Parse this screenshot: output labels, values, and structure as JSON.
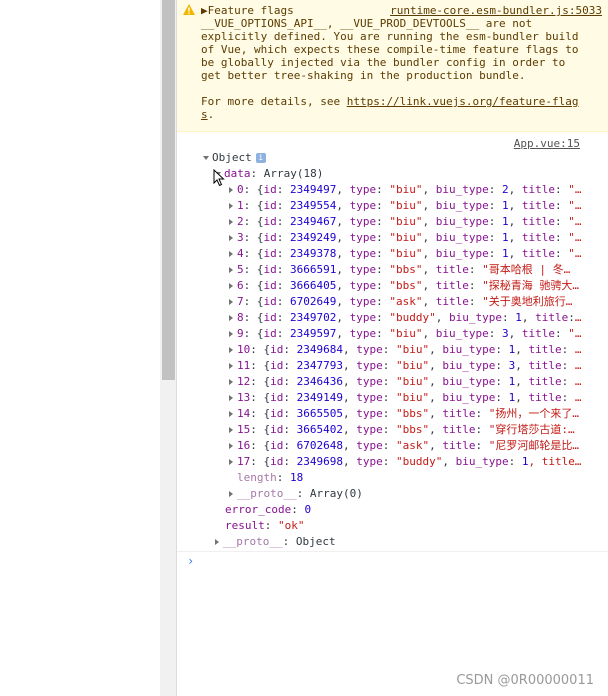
{
  "warning": {
    "message": "▶Feature flags\n__VUE_OPTIONS_API__, __VUE_PROD_DEVTOOLS__ are not\nexplicitly defined. You are running the esm-bundler build\nof Vue, which expects these compile-time feature flags to\nbe globally injected via the bundler config in order to\nget better tree-shaking in the production bundle.\n\nFor more details, see ",
    "link_text": "https://link.vuejs.org/feature-flag",
    "link_tail": "s",
    "tail": ".",
    "source": "runtime-core.esm-bundler.js:5033"
  },
  "log": {
    "source": "App.vue:15",
    "object_label": "Object",
    "info_badge": "i",
    "data_key": "data",
    "data_preview": "Array(18)",
    "items": [
      {
        "idx": "0",
        "id": "2349497",
        "type": "\"biu\"",
        "extra": ", biu_type: ",
        "extra_num": "2",
        "tail": ", title: \"…"
      },
      {
        "idx": "1",
        "id": "2349554",
        "type": "\"biu\"",
        "extra": ", biu_type: ",
        "extra_num": "1",
        "tail": ", title: \"…"
      },
      {
        "idx": "2",
        "id": "2349467",
        "type": "\"biu\"",
        "extra": ", biu_type: ",
        "extra_num": "1",
        "tail": ", title: \"…"
      },
      {
        "idx": "3",
        "id": "2349249",
        "type": "\"biu\"",
        "extra": ", biu_type: ",
        "extra_num": "1",
        "tail": ", title: \"…"
      },
      {
        "idx": "4",
        "id": "2349378",
        "type": "\"biu\"",
        "extra": ", biu_type: ",
        "extra_num": "1",
        "tail": ", title: \"…"
      },
      {
        "idx": "5",
        "id": "3666591",
        "type": "\"bbs\"",
        "extra": ", title: ",
        "extra_num": "",
        "tail": "\"哥本哈根 | 冬…"
      },
      {
        "idx": "6",
        "id": "3666405",
        "type": "\"bbs\"",
        "extra": ", title: ",
        "extra_num": "",
        "tail": "\"探秘青海 驰骋大…"
      },
      {
        "idx": "7",
        "id": "6702649",
        "type": "\"ask\"",
        "extra": ", title: ",
        "extra_num": "",
        "tail": "\"关于奥地利旅行…"
      },
      {
        "idx": "8",
        "id": "2349702",
        "type": "\"buddy\"",
        "extra": ", biu_type: ",
        "extra_num": "1",
        "tail": ", title:…"
      },
      {
        "idx": "9",
        "id": "2349597",
        "type": "\"biu\"",
        "extra": ", biu_type: ",
        "extra_num": "3",
        "tail": ", title: \"…"
      },
      {
        "idx": "10",
        "id": "2349684",
        "type": "\"biu\"",
        "extra": ", biu_type: ",
        "extra_num": "1",
        "tail": ", title: …"
      },
      {
        "idx": "11",
        "id": "2347793",
        "type": "\"biu\"",
        "extra": ", biu_type: ",
        "extra_num": "3",
        "tail": ", title: …"
      },
      {
        "idx": "12",
        "id": "2346436",
        "type": "\"biu\"",
        "extra": ", biu_type: ",
        "extra_num": "1",
        "tail": ", title: …"
      },
      {
        "idx": "13",
        "id": "2349149",
        "type": "\"biu\"",
        "extra": ", biu_type: ",
        "extra_num": "1",
        "tail": ", title: …"
      },
      {
        "idx": "14",
        "id": "3665505",
        "type": "\"bbs\"",
        "extra": ", title: ",
        "extra_num": "",
        "tail": "\"扬州，一个来了…"
      },
      {
        "idx": "15",
        "id": "3665402",
        "type": "\"bbs\"",
        "extra": ", title: ",
        "extra_num": "",
        "tail": "\"穿行塔莎古道:…"
      },
      {
        "idx": "16",
        "id": "6702648",
        "type": "\"ask\"",
        "extra": ", title: ",
        "extra_num": "",
        "tail": "\"尼罗河邮轮是比…"
      },
      {
        "idx": "17",
        "id": "2349698",
        "type": "\"buddy\"",
        "extra": ", biu_type: ",
        "extra_num": "1",
        "tail": ", title…"
      }
    ],
    "length_key": "length",
    "length_val": "18",
    "array_proto_key": "__proto__",
    "array_proto_val": "Array(0)",
    "error_code_key": "error_code",
    "error_code_val": "0",
    "result_key": "result",
    "result_val": "\"ok\"",
    "object_proto_key": "__proto__",
    "object_proto_val": "Object"
  },
  "prompt_symbol": "›",
  "watermark": "CSDN @0R00000011",
  "colors": {
    "key": "#881391",
    "number": "#1c00cf",
    "string": "#c41a16",
    "warning_bg": "#fffbe5",
    "prompt": "#367cf1"
  }
}
